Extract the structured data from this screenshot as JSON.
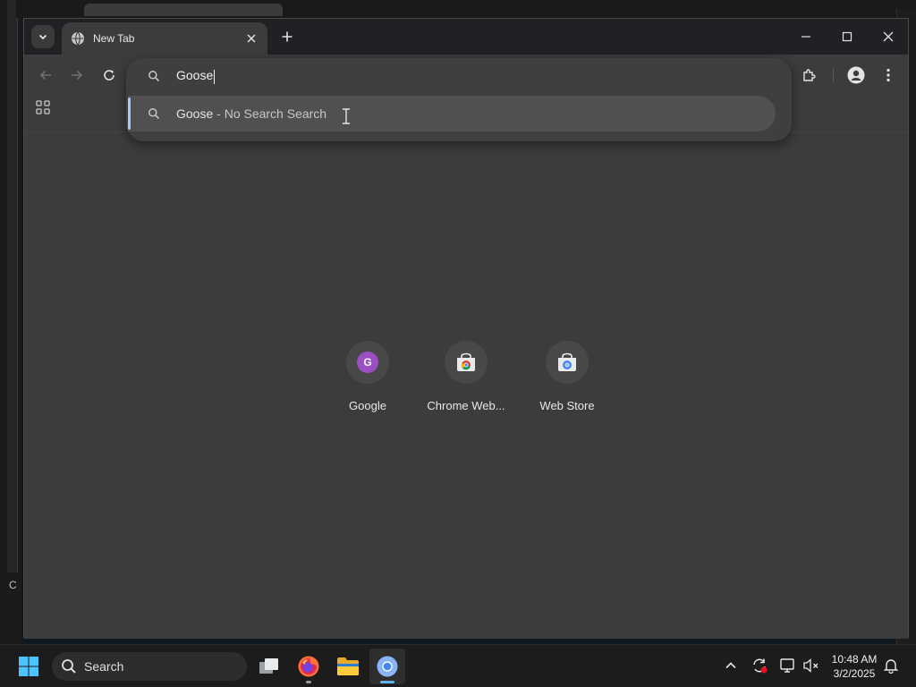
{
  "browser": {
    "tab": {
      "title": "New Tab"
    },
    "omnibox": {
      "query": "Goose"
    },
    "suggestion": {
      "text": "Goose",
      "separator": " - ",
      "description": "No Search Search"
    },
    "shortcuts": [
      {
        "label": "Google",
        "badge_letter": "G",
        "icon": "google-letter-icon"
      },
      {
        "label": "Chrome Web...",
        "icon": "chrome-web-store-icon"
      },
      {
        "label": "Web Store",
        "icon": "web-store-icon"
      }
    ]
  },
  "background": {
    "edge_text": "C"
  },
  "taskbar": {
    "search_label": "Search",
    "apps": [
      "task-view-icon",
      "firefox-icon",
      "file-explorer-icon",
      "chrome-icon"
    ],
    "clock": {
      "time": "10:48 AM",
      "date": "3/2/2025"
    }
  },
  "colors": {
    "accent": "#a8c7fa",
    "google_badge": "#9c4fc4",
    "taskbar_active": "#5fb2f2"
  }
}
